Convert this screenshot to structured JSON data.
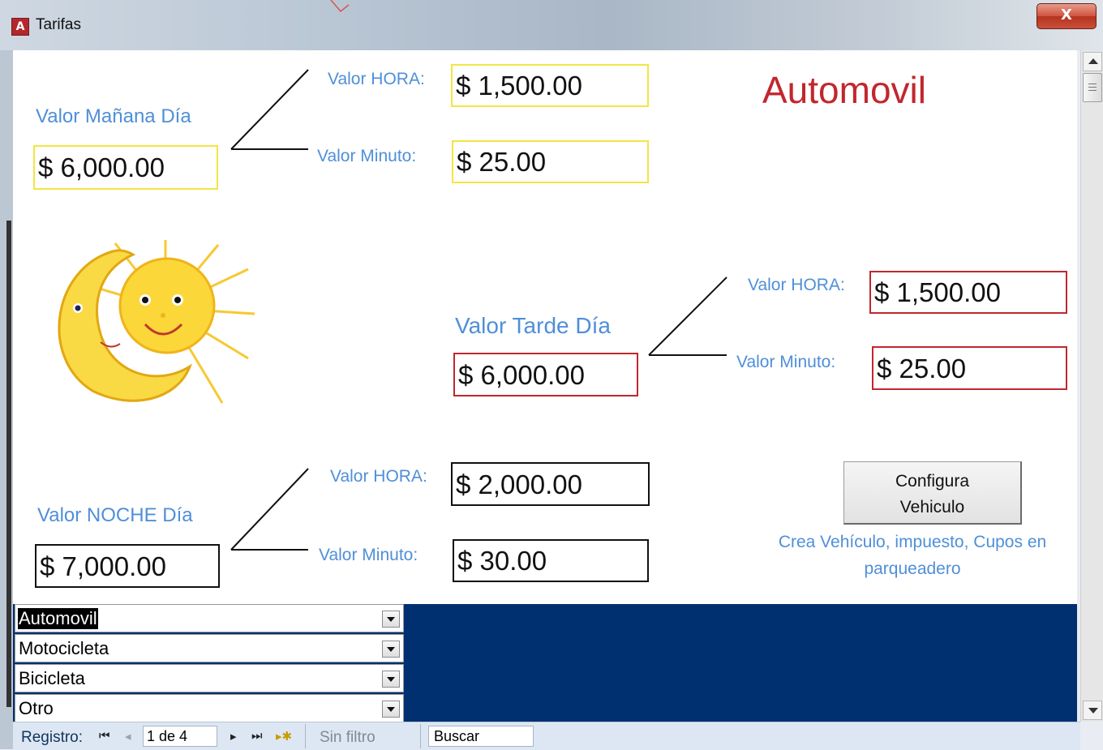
{
  "window": {
    "title": "Tarifas",
    "close_label": "X"
  },
  "vehicle_heading": "Automovil",
  "manana": {
    "label": "Valor Mañana Día",
    "value": "$ 6,000.00",
    "hora_label": "Valor HORA:",
    "hora_value": "$ 1,500.00",
    "minuto_label": "Valor Minuto:",
    "minuto_value": "$ 25.00"
  },
  "tarde": {
    "label": "Valor Tarde Día",
    "value": "$ 6,000.00",
    "hora_label": "Valor HORA:",
    "hora_value": "$ 1,500.00",
    "minuto_label": "Valor Minuto:",
    "minuto_value": "$ 25.00"
  },
  "noche": {
    "label": "Valor NOCHE Día",
    "value": "$ 7,000.00",
    "hora_label": "Valor HORA:",
    "hora_value": "$ 2,000.00",
    "minuto_label": "Valor Minuto:",
    "minuto_value": "$ 30.00"
  },
  "config_button": {
    "line1": "Configura",
    "line2": "Vehiculo"
  },
  "config_description": "Crea Vehículo, impuesto, Cupos en parqueadero",
  "vehicles": [
    "Automovil",
    "Motocicleta",
    "Bicicleta",
    "Otro"
  ],
  "navigation": {
    "record_label": "Registro:",
    "first": "⏮",
    "prev": "◂",
    "record_value": "1 de 4",
    "next": "▸",
    "last": "⏭",
    "new": "▸✱",
    "filter_label": "Sin filtro",
    "search_label": "Buscar"
  },
  "colors": {
    "label_blue": "#4f8fd9",
    "heading_red": "#c1272d",
    "morning_border": "#f4e542",
    "afternoon_border": "#c1272d",
    "night_border": "#111111",
    "subform_bg": "#003070"
  },
  "icons": [
    "access-app-icon",
    "sun-moon-illustration"
  ]
}
